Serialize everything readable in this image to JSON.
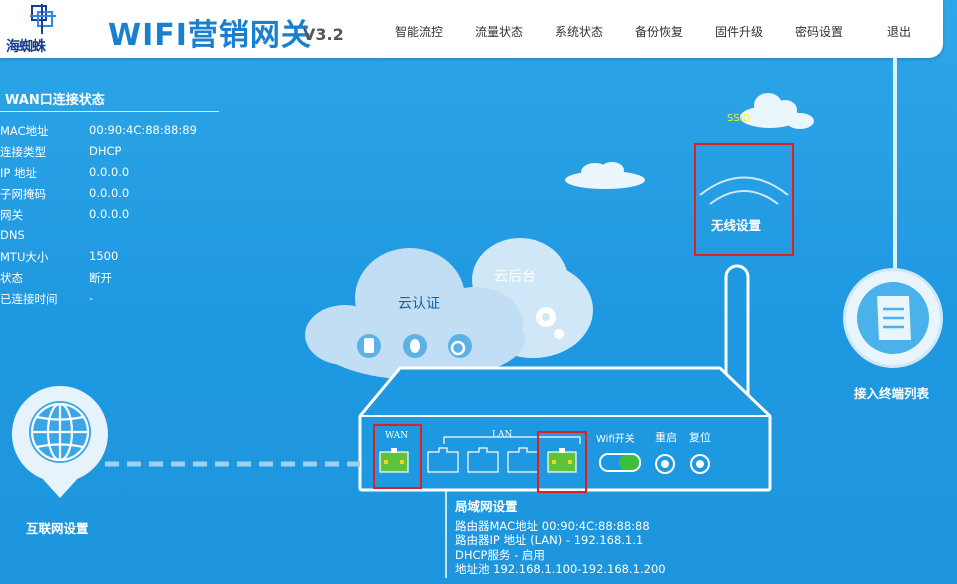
{
  "header": {
    "logo_text": "海蜘蛛",
    "brand": "WIFI营销网关",
    "version": "V3.2",
    "nav": [
      {
        "label": "智能流控"
      },
      {
        "label": "流量状态"
      },
      {
        "label": "系统状态"
      },
      {
        "label": "备份恢复"
      },
      {
        "label": "固件升级"
      },
      {
        "label": "密码设置"
      },
      {
        "label": "退出"
      }
    ]
  },
  "wan_status": {
    "title": "WAN口连接状态",
    "rows": [
      {
        "key": "MAC地址",
        "value": "00:90:4C:88:88:89"
      },
      {
        "key": "连接类型",
        "value": "DHCP"
      },
      {
        "key": "IP 地址",
        "value": "0.0.0.0"
      },
      {
        "key": "子网掩码",
        "value": "0.0.0.0"
      },
      {
        "key": "网关",
        "value": "0.0.0.0"
      },
      {
        "key": "DNS",
        "value": ""
      },
      {
        "key": "MTU大小",
        "value": "1500"
      },
      {
        "key": "状态",
        "value": "断开"
      },
      {
        "key": "已连接时间",
        "value": "-"
      }
    ]
  },
  "cloud": {
    "auth_label": "云认证",
    "backend_label": "云后台"
  },
  "ssid_label": "SSID",
  "wireless_label": "无线设置",
  "clients_label": "接入终端列表",
  "internet_label": "互联网设置",
  "router": {
    "wan_label": "WAN",
    "lan_label": "LAN",
    "wifi_switch_label": "Wifi开关",
    "reboot_label": "重启",
    "reset_label": "复位"
  },
  "lan_info": {
    "title": "局域网设置",
    "lines": [
      "路由器MAC地址 00:90:4C:88:88:88",
      "路由器IP 地址 (LAN) - 192.168.1.1",
      "DHCP服务 - 启用",
      "地址池 192.168.1.100-192.168.1.200"
    ]
  },
  "colors": {
    "background": "#1e98e0",
    "port_active": "#5ec33a",
    "highlight_box": "#e02020",
    "brand": "#1b7fcf"
  }
}
